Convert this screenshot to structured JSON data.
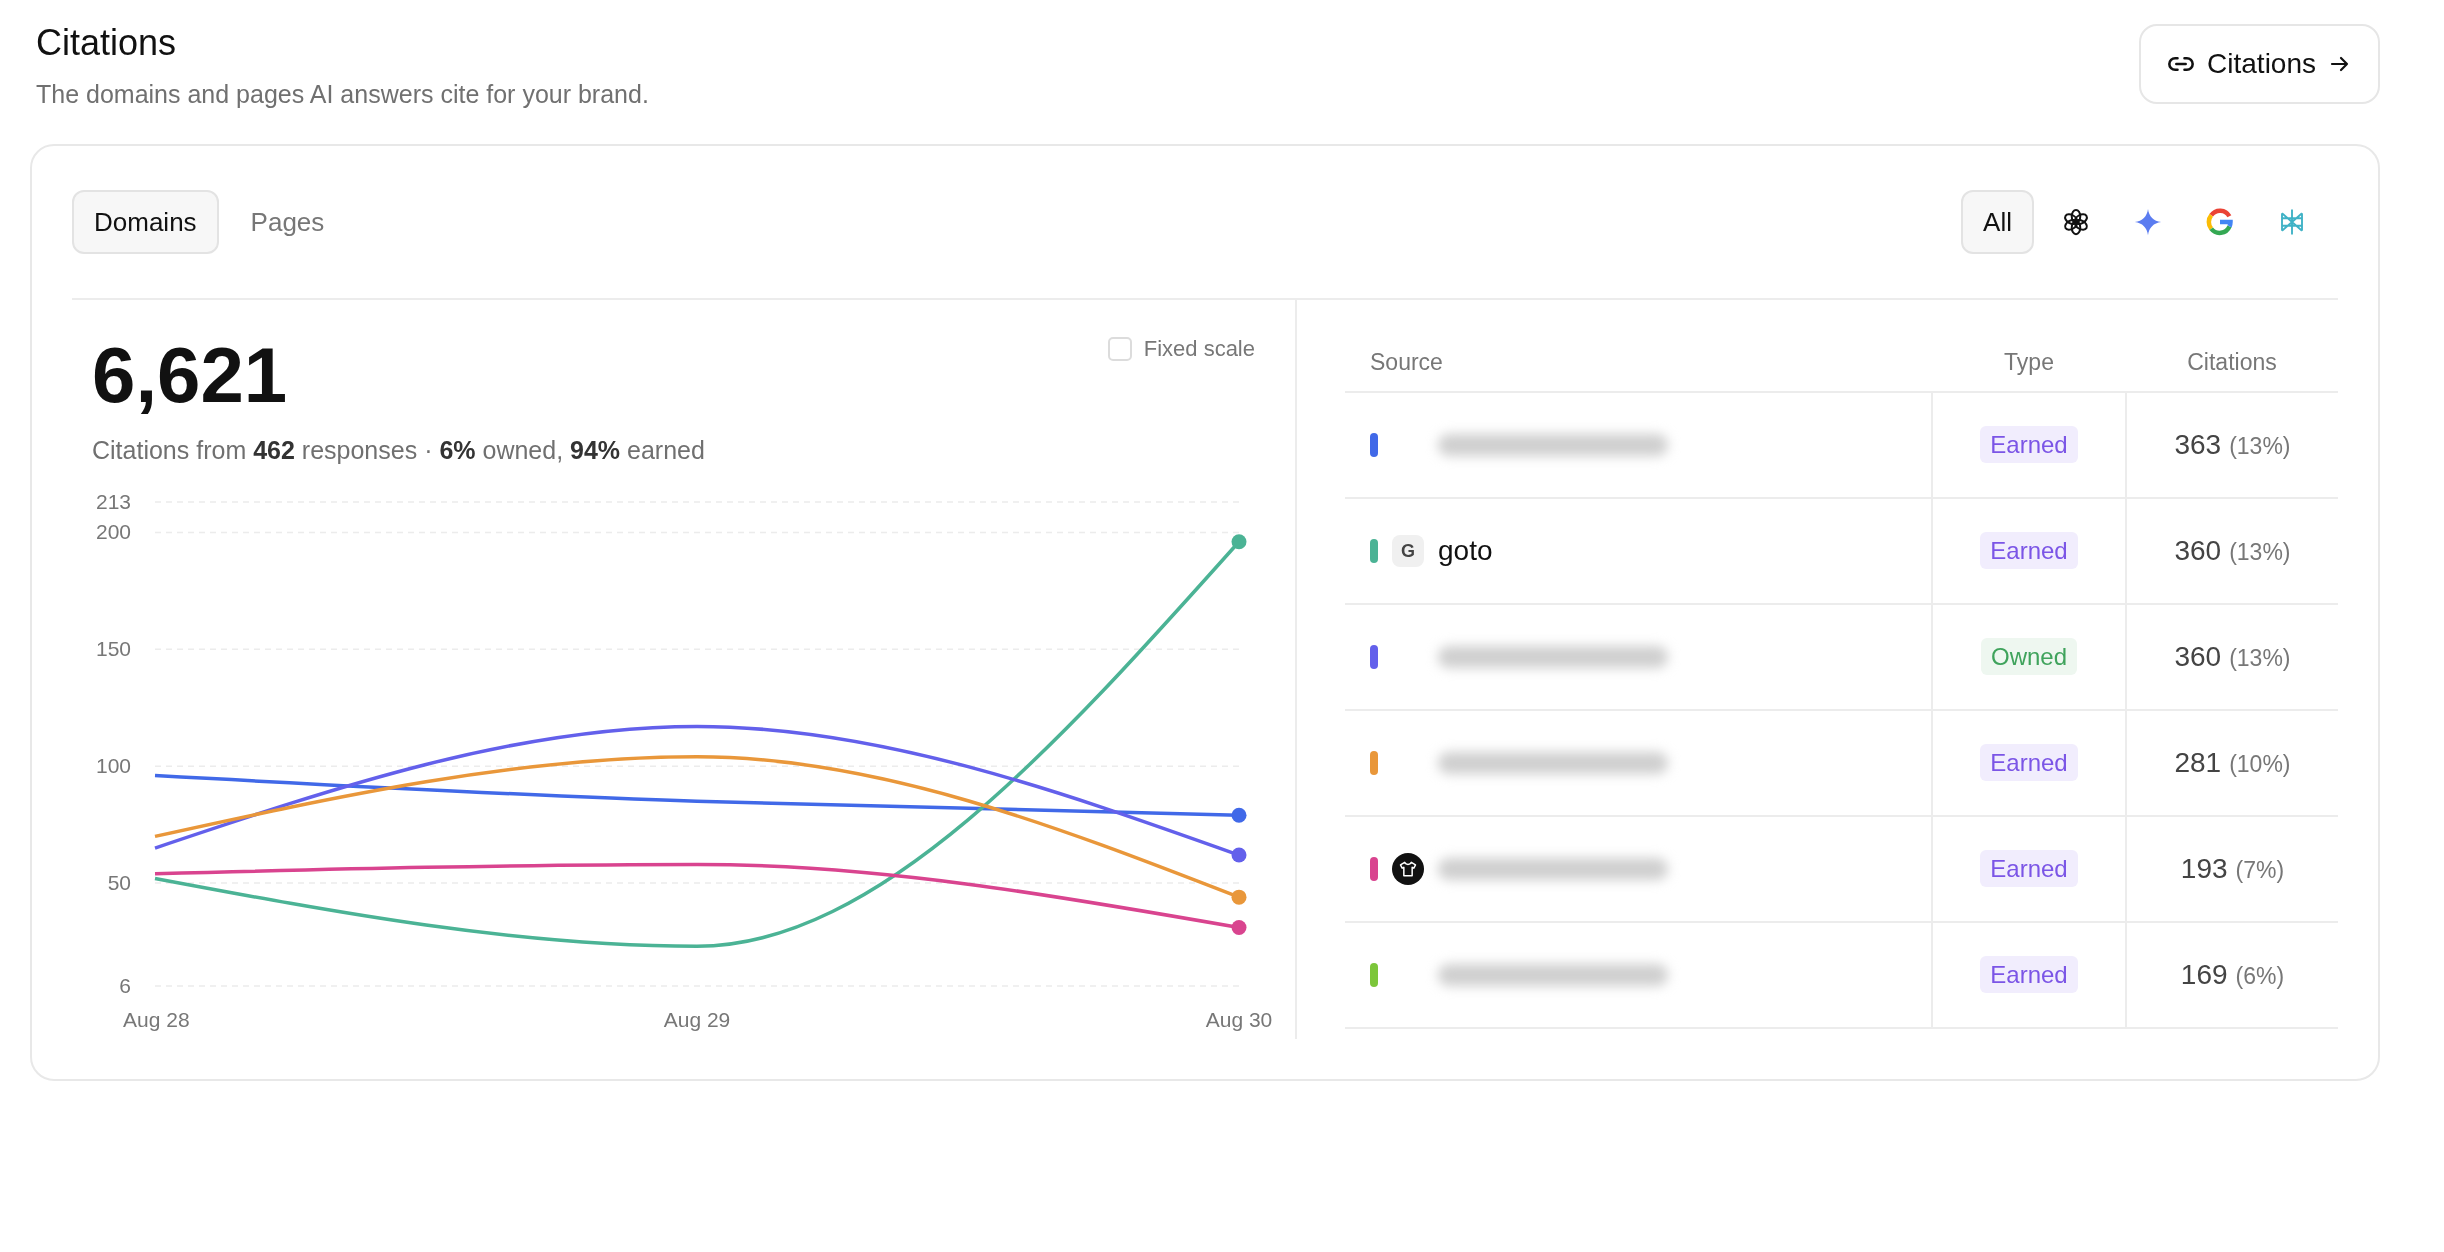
{
  "header": {
    "title": "Citations",
    "subtitle": "The domains and pages AI answers cite for your brand.",
    "link_button": {
      "label": "Citations"
    }
  },
  "tabs": [
    {
      "label": "Domains",
      "selected": true
    },
    {
      "label": "Pages",
      "selected": false
    }
  ],
  "filters": [
    {
      "kind": "text",
      "label": "All",
      "selected": true
    },
    {
      "kind": "knot",
      "selected": false
    },
    {
      "kind": "sparkle",
      "selected": false
    },
    {
      "kind": "g",
      "selected": false
    },
    {
      "kind": "asterisk",
      "selected": false
    }
  ],
  "summary": {
    "total": "6,621",
    "description": "Citations from **462** responses · **6%** owned, **94%** earned"
  },
  "fixed_scale": {
    "label": "Fixed scale",
    "checked": false
  },
  "chart_data": {
    "type": "line",
    "grid": true,
    "categories": [
      "Aug 28",
      "Aug 29",
      "Aug 30"
    ],
    "ylim": [
      6,
      213
    ],
    "yticks": [
      6,
      50,
      100,
      150,
      200,
      213
    ],
    "series": [
      {
        "color": "#4169e8",
        "values": [
          96,
          85,
          79
        ]
      },
      {
        "color": "#4bb395",
        "values": [
          52,
          23,
          196
        ]
      },
      {
        "color": "#6360eb",
        "values": [
          65,
          117,
          62
        ]
      },
      {
        "color": "#e9973a",
        "values": [
          70,
          104,
          44
        ]
      },
      {
        "color": "#d9448f",
        "values": [
          54,
          58,
          31
        ]
      }
    ]
  },
  "table": {
    "columns": [
      "Source",
      "Type",
      "Citations"
    ],
    "rows": [
      {
        "color": "#4169e8",
        "source": {
          "kind": "redacted"
        },
        "type": {
          "kind": "earned",
          "label": "Earned"
        },
        "count": "363",
        "share": "(13%)"
      },
      {
        "color": "#4bb395",
        "source": {
          "kind": "named",
          "name": "goto"
        },
        "favicon": {
          "kind": "letter",
          "text": "G"
        },
        "type": {
          "kind": "earned",
          "label": "Earned"
        },
        "count": "360",
        "share": "(13%)"
      },
      {
        "color": "#6360eb",
        "source": {
          "kind": "redacted"
        },
        "type": {
          "kind": "owned",
          "label": "Owned"
        },
        "count": "360",
        "share": "(13%)"
      },
      {
        "color": "#e9973a",
        "source": {
          "kind": "redacted"
        },
        "type": {
          "kind": "earned",
          "label": "Earned"
        },
        "count": "281",
        "share": "(10%)"
      },
      {
        "color": "#d9448f",
        "source": {
          "kind": "redacted"
        },
        "favicon": {
          "kind": "shirt"
        },
        "type": {
          "kind": "earned",
          "label": "Earned"
        },
        "count": "193",
        "share": "(7%)"
      },
      {
        "color": "#7cc63a",
        "source": {
          "kind": "redacted"
        },
        "type": {
          "kind": "earned",
          "label": "Earned"
        },
        "count": "169",
        "share": "(6%)"
      }
    ]
  }
}
